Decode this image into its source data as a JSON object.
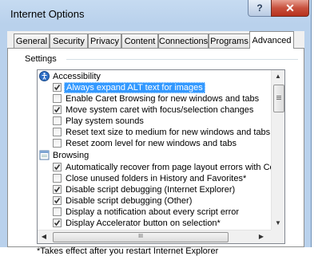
{
  "window": {
    "title": "Internet Options",
    "help_glyph": "?",
    "close_glyph": "✕"
  },
  "tabs": [
    {
      "label": "General"
    },
    {
      "label": "Security"
    },
    {
      "label": "Privacy"
    },
    {
      "label": "Content"
    },
    {
      "label": "Connections"
    },
    {
      "label": "Programs"
    },
    {
      "label": "Advanced",
      "active": true
    }
  ],
  "settings": {
    "label": "Settings",
    "items": [
      {
        "type": "category",
        "label": "Accessibility",
        "icon": "accessibility-icon"
      },
      {
        "type": "checkbox",
        "label": "Always expand ALT text for images",
        "checked": true,
        "selected": true
      },
      {
        "type": "checkbox",
        "label": "Enable Caret Browsing for new windows and tabs",
        "checked": false
      },
      {
        "type": "checkbox",
        "label": "Move system caret with focus/selection changes",
        "checked": true
      },
      {
        "type": "checkbox",
        "label": "Play system sounds",
        "checked": false
      },
      {
        "type": "checkbox",
        "label": "Reset text size to medium for new windows and tabs",
        "checked": false
      },
      {
        "type": "checkbox",
        "label": "Reset zoom level for new windows and tabs",
        "checked": false
      },
      {
        "type": "category",
        "label": "Browsing",
        "icon": "browsing-page-icon"
      },
      {
        "type": "checkbox",
        "label": "Automatically recover from page layout errors with Compa",
        "checked": true
      },
      {
        "type": "checkbox",
        "label": "Close unused folders in History and Favorites*",
        "checked": false
      },
      {
        "type": "checkbox",
        "label": "Disable script debugging (Internet Explorer)",
        "checked": true
      },
      {
        "type": "checkbox",
        "label": "Disable script debugging (Other)",
        "checked": true
      },
      {
        "type": "checkbox",
        "label": "Display a notification about every script error",
        "checked": false
      },
      {
        "type": "checkbox",
        "label": "Display Accelerator button on selection*",
        "checked": true
      }
    ]
  },
  "scrollbars": {
    "up": "▲",
    "down": "▼",
    "left": "◀",
    "right": "▶",
    "hthumb_grip": "III"
  },
  "footnote": "*Takes effect after you restart Internet Explorer",
  "colors": {
    "selection": "#3399ff",
    "title_gradient": "#b9d1ec",
    "close_button": "#c8513e"
  }
}
